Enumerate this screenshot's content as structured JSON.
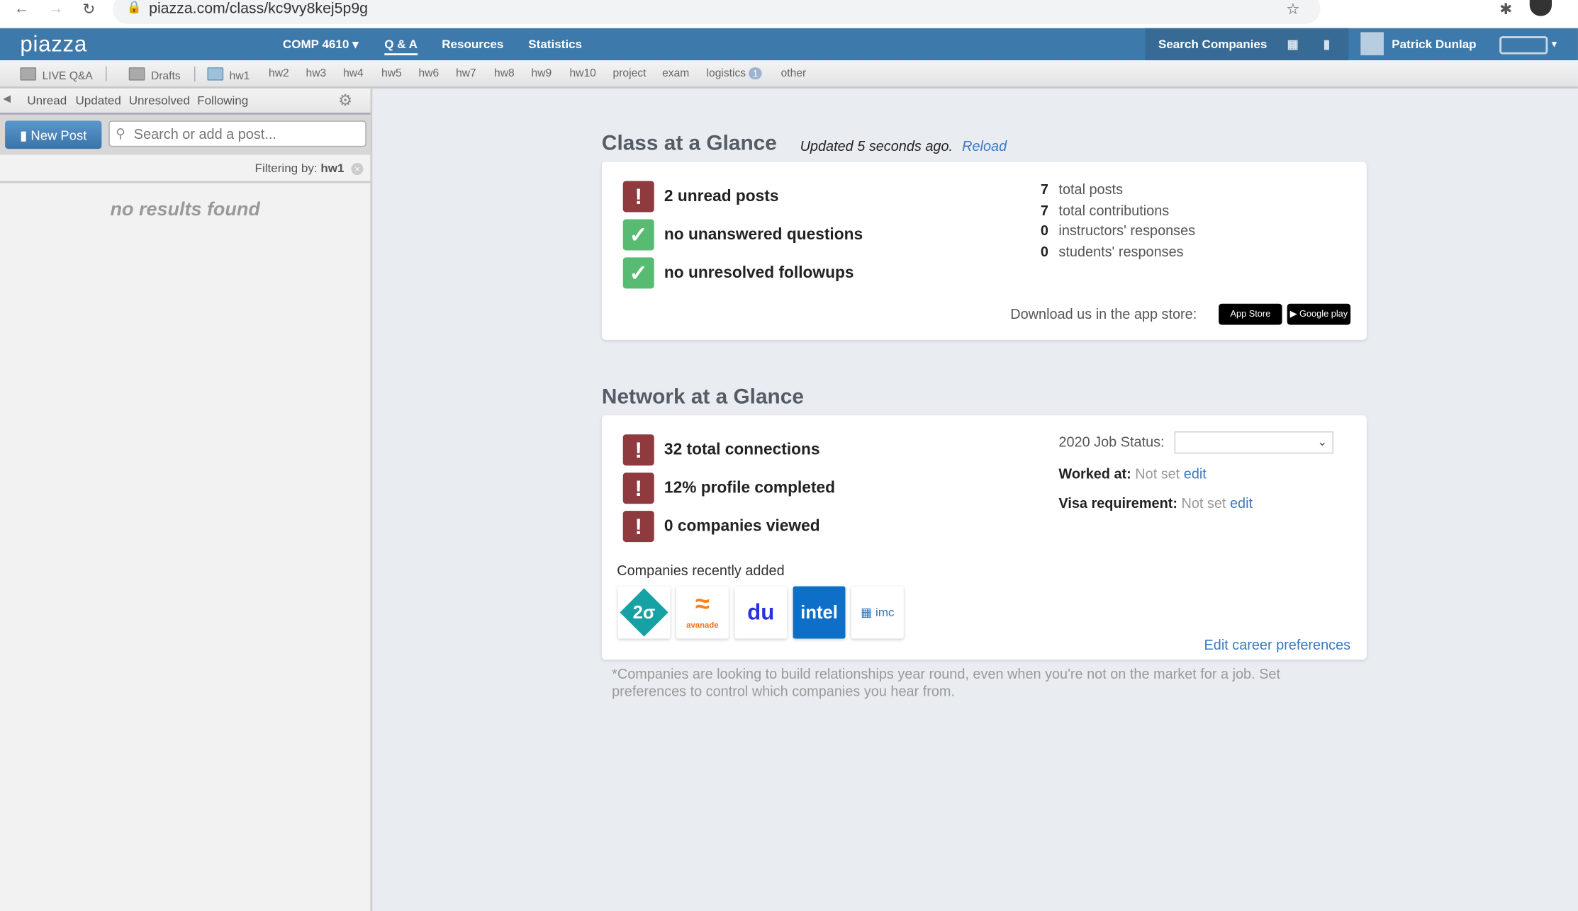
{
  "browser": {
    "url": "piazza.com/class/kc9vy8kej5p9g"
  },
  "nav": {
    "logo": "piazza",
    "course": "COMP 4610 ▾",
    "links": [
      "Q & A",
      "Resources",
      "Statistics"
    ],
    "search_companies": "Search Companies",
    "user": "Patrick Dunlap"
  },
  "folders": {
    "live": "LIVE Q&A",
    "drafts": "Drafts",
    "items": [
      "hw1",
      "hw2",
      "hw3",
      "hw4",
      "hw5",
      "hw6",
      "hw7",
      "hw8",
      "hw9",
      "hw10",
      "project",
      "exam",
      "logistics",
      "other"
    ],
    "logistics_badge": "1"
  },
  "sidebar": {
    "filters": [
      "Unread",
      "Updated",
      "Unresolved",
      "Following"
    ],
    "new_post": "New Post",
    "search_placeholder": "Search or add a post...",
    "filtering_label": "Filtering by:",
    "filtering_value": "hw1",
    "no_results": "no results found"
  },
  "class_glance": {
    "title": "Class at a Glance",
    "updated": "Updated  5 seconds ago.",
    "reload": "Reload",
    "rows": [
      {
        "text": "2 unread posts",
        "status": "alert"
      },
      {
        "text": "no unanswered questions",
        "status": "ok"
      },
      {
        "text": "no unresolved followups",
        "status": "ok"
      }
    ],
    "stats": [
      {
        "n": "7",
        "label": "total posts"
      },
      {
        "n": "7",
        "label": "total contributions"
      },
      {
        "n": "0",
        "label": "instructors' responses"
      },
      {
        "n": "0",
        "label": "students' responses"
      }
    ],
    "download": "Download us in the app store:",
    "app_store": "App Store",
    "google_play": "Google play"
  },
  "network_glance": {
    "title": "Network at a Glance",
    "rows": [
      {
        "text": "32 total connections"
      },
      {
        "text": "12% profile completed"
      },
      {
        "text": "0 companies viewed"
      }
    ],
    "job_status_label": "2020 Job Status:",
    "job_status_value": "",
    "worked_label": "Worked at:",
    "worked_value": "Not set",
    "visa_label": "Visa requirement:",
    "visa_value": "Not set",
    "edit": "edit",
    "companies_label": "Companies recently added",
    "companies": [
      "2σ",
      "avanade",
      "du",
      "intel",
      "imc"
    ],
    "edit_prefs": "Edit career preferences",
    "footnote": "*Companies are looking to build relationships year round, even when you're not on the market for a job. Set preferences to control which companies you hear from."
  },
  "colors": {
    "nav": "#3e79ab",
    "alert": "#8e3a3f",
    "ok": "#58bb72",
    "link": "#3b78c2"
  }
}
